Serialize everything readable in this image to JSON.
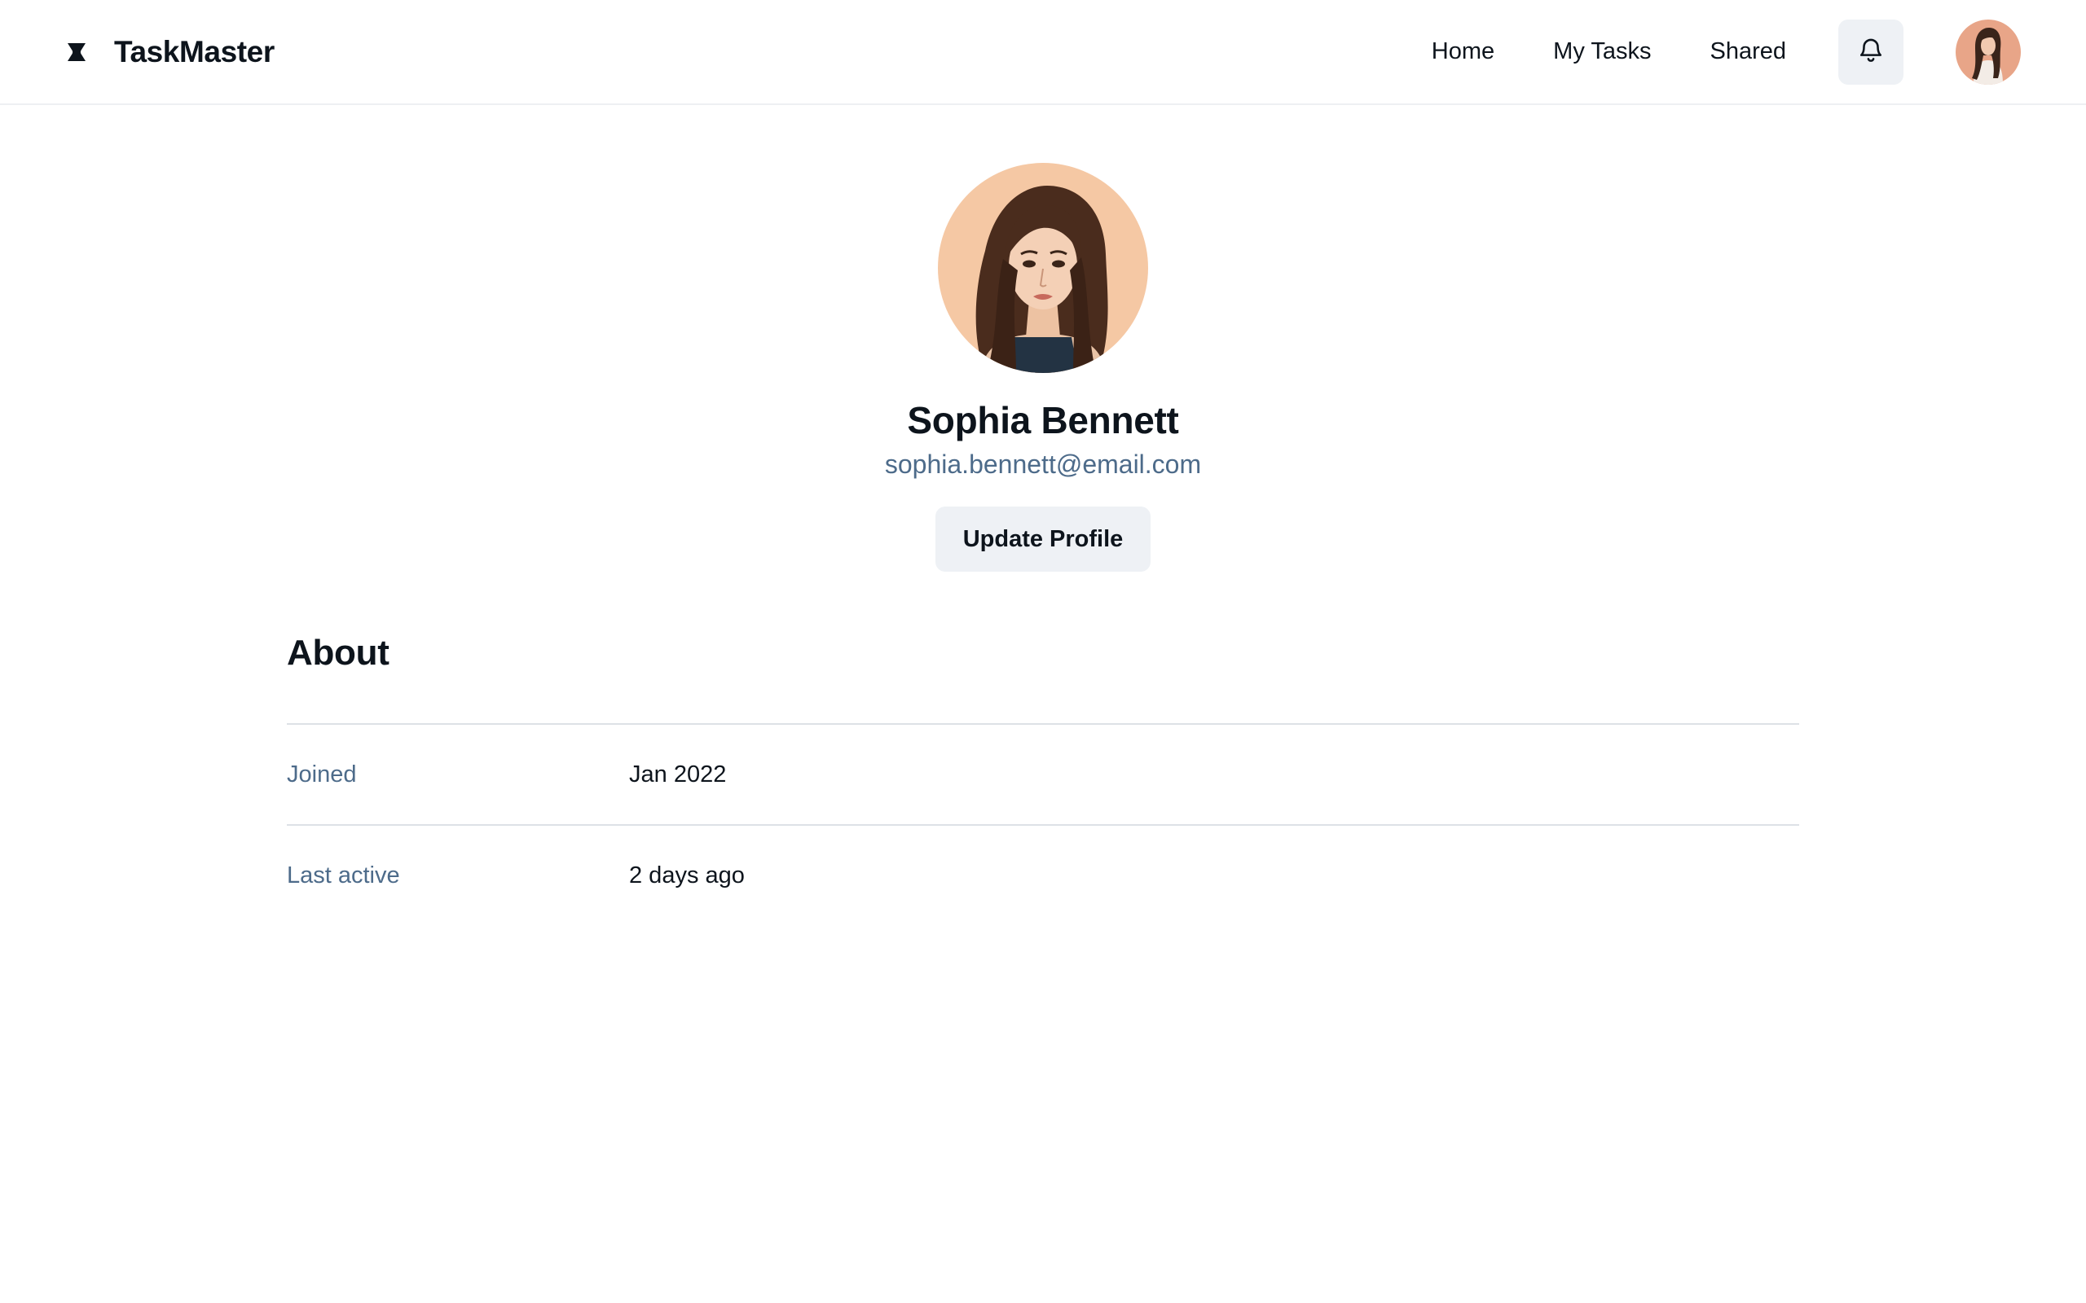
{
  "app": {
    "name": "TaskMaster",
    "logo_icon": "hourglass-logo-icon"
  },
  "nav": {
    "items": [
      {
        "label": "Home"
      },
      {
        "label": "My Tasks"
      },
      {
        "label": "Shared"
      }
    ],
    "notifications_icon": "bell-icon",
    "user_avatar": "user-avatar"
  },
  "profile": {
    "name": "Sophia Bennett",
    "email": "sophia.bennett@email.com",
    "update_label": "Update Profile"
  },
  "about": {
    "title": "About",
    "rows": [
      {
        "label": "Joined",
        "value": "Jan 2022"
      },
      {
        "label": "Last active",
        "value": "2 days ago"
      }
    ]
  },
  "colors": {
    "text": "#0d141c",
    "muted": "#4d6b8a",
    "button_bg": "#eef1f5",
    "divider": "#dde1e6"
  }
}
